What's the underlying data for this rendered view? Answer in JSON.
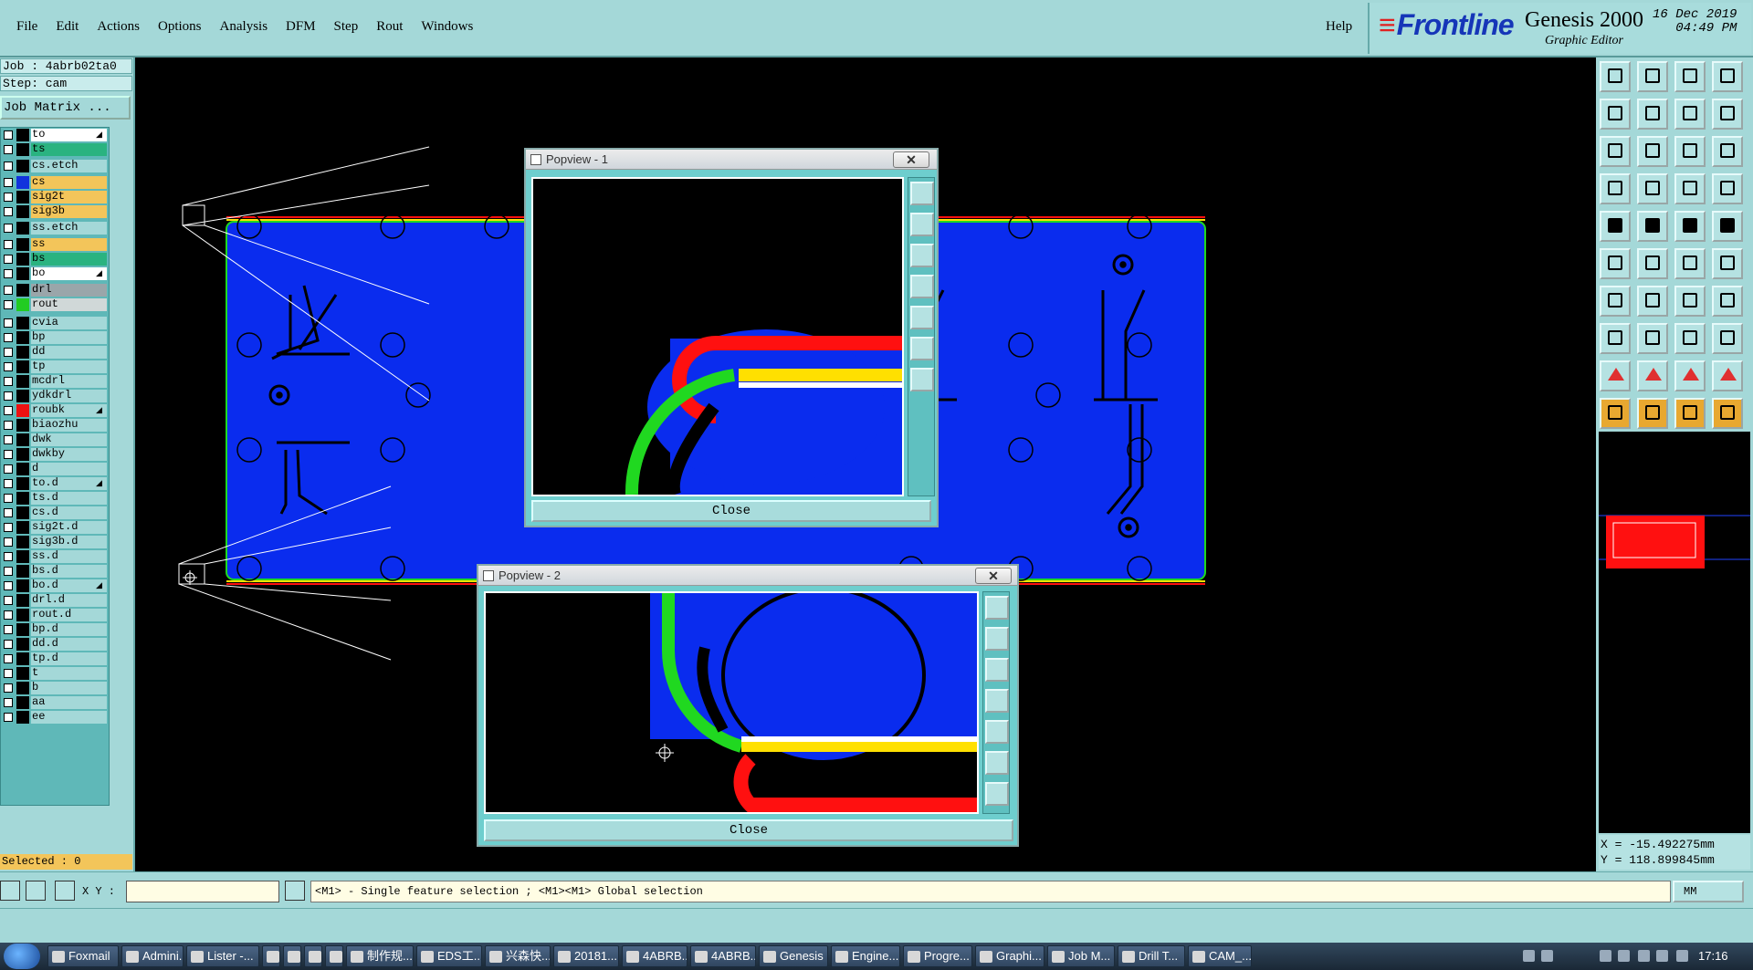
{
  "app": {
    "menu": [
      "File",
      "Edit",
      "Actions",
      "Options",
      "Analysis",
      "DFM",
      "Step",
      "Rout",
      "Windows"
    ],
    "help": "Help",
    "brand": "Frontline",
    "product": "Genesis 2000",
    "subtitle": "Graphic Editor",
    "date": "16 Dec 2019",
    "time": "04:49 PM"
  },
  "job": {
    "job_label": "Job : 4abrb02ta0",
    "step_label": "Step: cam",
    "matrix_button": "Job Matrix ..."
  },
  "layers": [
    {
      "name": "to",
      "color": "#000000",
      "label_bg": "#ffffff",
      "arrow": true
    },
    {
      "name": "ts",
      "color": "#000000",
      "label_bg": "#2ab380"
    },
    {
      "name": "cs.etch",
      "color": "#000000",
      "label_bg": "#a4d8d8"
    },
    {
      "name": "cs",
      "color": "#1133dd",
      "label_bg": "#f3c55a"
    },
    {
      "name": "sig2t",
      "color": "#000000",
      "label_bg": "#f3c55a"
    },
    {
      "name": "sig3b",
      "color": "#000000",
      "label_bg": "#f3c55a"
    },
    {
      "name": "ss.etch",
      "color": "#000000",
      "label_bg": "#a4d8d8"
    },
    {
      "name": "ss",
      "color": "#000000",
      "label_bg": "#f3c55a"
    },
    {
      "name": "bs",
      "color": "#000000",
      "label_bg": "#2ab380"
    },
    {
      "name": "bo",
      "color": "#000000",
      "label_bg": "#ffffff",
      "arrow": true
    },
    {
      "name": "drl",
      "color": "#000000",
      "label_bg": "#9aa6aa"
    },
    {
      "name": "rout",
      "color": "#22cc22",
      "label_bg": "#d0d8d8"
    },
    {
      "name": "cvia",
      "color": "#000000",
      "label_bg": "#a4d8d8"
    },
    {
      "name": "bp",
      "color": "#000000",
      "label_bg": "#a4d8d8"
    },
    {
      "name": "dd",
      "color": "#000000",
      "label_bg": "#a4d8d8"
    },
    {
      "name": "tp",
      "color": "#000000",
      "label_bg": "#a4d8d8"
    },
    {
      "name": "mcdrl",
      "color": "#000000",
      "label_bg": "#a4d8d8"
    },
    {
      "name": "ydkdrl",
      "color": "#000000",
      "label_bg": "#a4d8d8"
    },
    {
      "name": "roubk",
      "color": "#ee1111",
      "label_bg": "#a4d8d8",
      "arrow": true
    },
    {
      "name": "biaozhu",
      "color": "#000000",
      "label_bg": "#a4d8d8"
    },
    {
      "name": "dwk",
      "color": "#000000",
      "label_bg": "#a4d8d8"
    },
    {
      "name": "dwkby",
      "color": "#000000",
      "label_bg": "#a4d8d8"
    },
    {
      "name": "d",
      "color": "#000000",
      "label_bg": "#a4d8d8"
    },
    {
      "name": "to.d",
      "color": "#000000",
      "label_bg": "#a4d8d8",
      "arrow": true
    },
    {
      "name": "ts.d",
      "color": "#000000",
      "label_bg": "#a4d8d8"
    },
    {
      "name": "cs.d",
      "color": "#000000",
      "label_bg": "#a4d8d8"
    },
    {
      "name": "sig2t.d",
      "color": "#000000",
      "label_bg": "#a4d8d8"
    },
    {
      "name": "sig3b.d",
      "color": "#000000",
      "label_bg": "#a4d8d8"
    },
    {
      "name": "ss.d",
      "color": "#000000",
      "label_bg": "#a4d8d8"
    },
    {
      "name": "bs.d",
      "color": "#000000",
      "label_bg": "#a4d8d8"
    },
    {
      "name": "bo.d",
      "color": "#000000",
      "label_bg": "#a4d8d8",
      "arrow": true
    },
    {
      "name": "drl.d",
      "color": "#000000",
      "label_bg": "#a4d8d8"
    },
    {
      "name": "rout.d",
      "color": "#000000",
      "label_bg": "#a4d8d8"
    },
    {
      "name": "bp.d",
      "color": "#000000",
      "label_bg": "#a4d8d8"
    },
    {
      "name": "dd.d",
      "color": "#000000",
      "label_bg": "#a4d8d8"
    },
    {
      "name": "tp.d",
      "color": "#000000",
      "label_bg": "#a4d8d8"
    },
    {
      "name": "t",
      "color": "#000000",
      "label_bg": "#a4d8d8"
    },
    {
      "name": "b",
      "color": "#000000",
      "label_bg": "#a4d8d8"
    },
    {
      "name": "aa",
      "color": "#000000",
      "label_bg": "#a4d8d8"
    },
    {
      "name": "ee",
      "color": "#000000",
      "label_bg": "#a4d8d8"
    }
  ],
  "selected": "Selected : 0",
  "popview1": {
    "title": "Popview - 1",
    "close_x": "✕",
    "close_button": "Close"
  },
  "popview2": {
    "title": "Popview - 2",
    "close_x": "✕",
    "close_button": "Close"
  },
  "toolbar_icons": [
    "zoom-home-icon",
    "layer-up-icon",
    "home-icon",
    "split-view-icon",
    "move-left-icon",
    "move-right-icon",
    "undo-icon",
    "redo-icon",
    "fit-icon",
    "center-icon",
    "scale-1-2-icon",
    "help-icon",
    "pen-icon",
    "grid-icon",
    "display-toggle-icon",
    "layer-toggle-icon",
    "pad-icon",
    "edit-shape-icon",
    "measure-icon",
    "circle-icon",
    "net-icon",
    "cross-icon",
    "line-dot-icon",
    "pencil-icon",
    "angle-icon",
    "diagonal-icon",
    "arc-icon",
    "text-icon",
    "snap-icon",
    "minus-icon",
    "node-icon",
    "group-icon",
    "triangle-icon",
    "triangle-a-icon",
    "triangle-b-icon",
    "triangle-c-icon",
    "pointer-icon",
    "select-icon",
    "select-alt-icon",
    "select-net-icon"
  ],
  "coords": {
    "x": "X = -15.492275mm",
    "y": "Y = 118.899845mm"
  },
  "status": {
    "xy_label": "X Y :",
    "hint": "<M1> - Single feature selection ; <M1><M1> Global selection",
    "units": "MM"
  },
  "taskbar": {
    "items": [
      "Foxmail",
      "Admini...",
      "Lister -...",
      "",
      "",
      "",
      "",
      "制作规...",
      "EDS工...",
      "兴森快...",
      "20181...",
      "4ABRB...",
      "4ABRB...",
      "Genesis",
      "Engine...",
      "Progre...",
      "Graphi...",
      "Job M...",
      "Drill T...",
      "CAM_..."
    ],
    "clock": "17:16"
  },
  "colors": {
    "board": "#0a2cee",
    "menu_bg": "#a4d8d8",
    "trace_red": "#ff1010",
    "trace_green": "#20d820",
    "trace_yellow": "#ffe000"
  }
}
